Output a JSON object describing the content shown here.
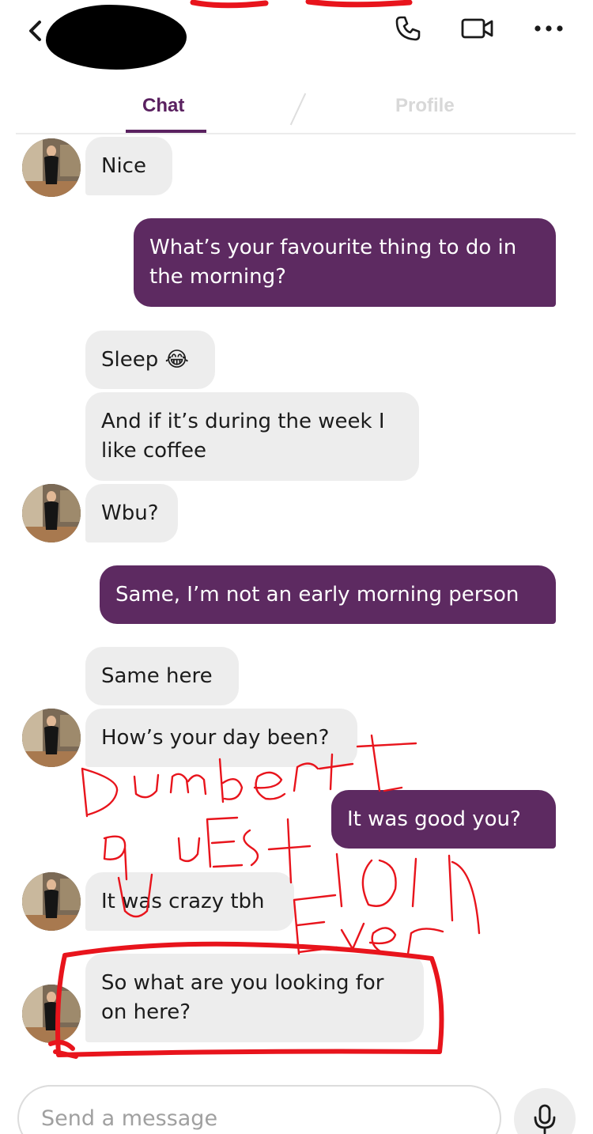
{
  "header": {
    "icons": {
      "back": "chevron-left-icon",
      "call": "phone-icon",
      "video": "video-camera-icon",
      "more": "more-horizontal-icon"
    }
  },
  "tabs": [
    {
      "label": "Chat",
      "active": true
    },
    {
      "label": "Profile",
      "active": false
    }
  ],
  "colors": {
    "accent": "#5d2a61",
    "incoming_bubble": "#ededed",
    "annotation": "#e8141c"
  },
  "messages": [
    {
      "side": "in",
      "text": "Nice"
    },
    {
      "side": "out",
      "text": "What’s your favourite thing to do in the morning?"
    },
    {
      "side": "in",
      "text": "Sleep 😂"
    },
    {
      "side": "in",
      "text": "And if it’s during the week I like coffee"
    },
    {
      "side": "in",
      "text": "Wbu?"
    },
    {
      "side": "out",
      "text": "Same, I’m not an early morning person"
    },
    {
      "side": "in",
      "text": "Same here"
    },
    {
      "side": "in",
      "text": "How’s your day been?"
    },
    {
      "side": "out",
      "text": "It was good you?"
    },
    {
      "side": "in",
      "text": "It was crazy tbh"
    },
    {
      "side": "in",
      "text": "So what are you looking for on here?"
    }
  ],
  "composer": {
    "placeholder": "Send a message",
    "mic_icon": "microphone-icon"
  }
}
